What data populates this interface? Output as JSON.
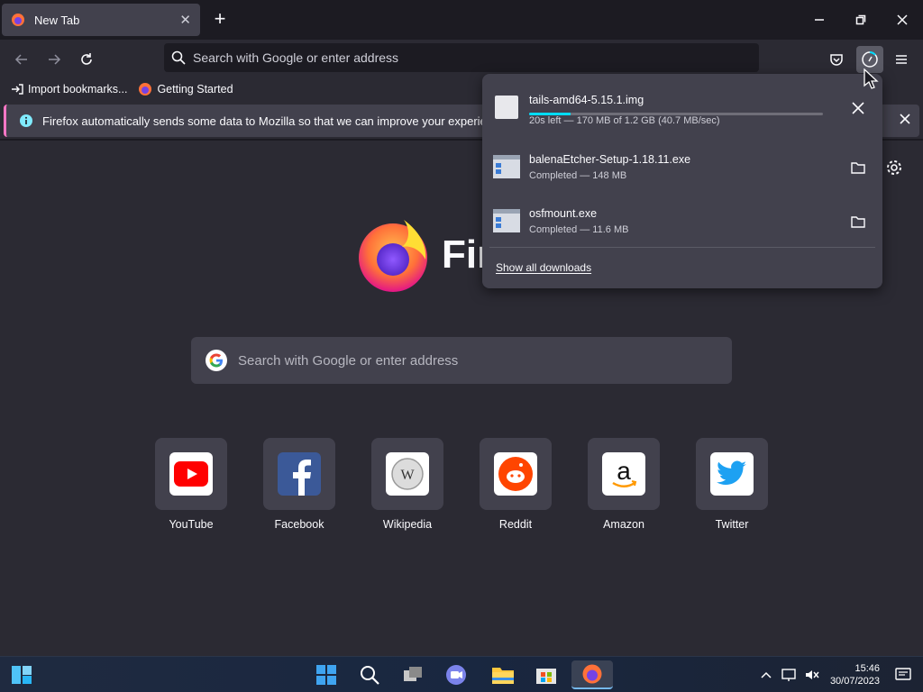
{
  "tabs": [
    {
      "title": "New Tab",
      "close_glyph": "✕"
    }
  ],
  "new_tab_glyph": "+",
  "window_controls": {
    "minimize": "minimize-icon",
    "restore": "restore-icon",
    "close": "close-icon"
  },
  "toolbar": {
    "address_placeholder": "Search with Google or enter address"
  },
  "bookmarks": [
    {
      "label": "Import bookmarks...",
      "icon": "import-icon"
    },
    {
      "label": "Getting Started",
      "icon": "firefox-icon"
    }
  ],
  "notification": {
    "text": "Firefox automatically sends some data to Mozilla so that we can improve your experience."
  },
  "page": {
    "wordmark": "Fir",
    "search_placeholder": "Search with Google or enter address",
    "top_sites": [
      {
        "label": "YouTube"
      },
      {
        "label": "Facebook"
      },
      {
        "label": "Wikipedia"
      },
      {
        "label": "Reddit"
      },
      {
        "label": "Amazon"
      },
      {
        "label": "Twitter"
      }
    ]
  },
  "downloads": {
    "items": [
      {
        "name": "tails-amd64-5.15.1.img",
        "status": "20s left — 170 MB of 1.2 GB (40.7 MB/sec)",
        "progress": 0.14,
        "action": "cancel-icon"
      },
      {
        "name": "balenaEtcher-Setup-1.18.11.exe",
        "status": "Completed — 148 MB",
        "action": "folder-icon"
      },
      {
        "name": "osfmount.exe",
        "status": "Completed — 11.6 MB",
        "action": "folder-icon"
      }
    ],
    "show_all": "Show all downloads"
  },
  "taskbar": {
    "time": "15:46",
    "date": "30/07/2023"
  },
  "colors": {
    "accent": "#00ddff",
    "notice_stripe": "#ff77c5",
    "chrome": "#1c1b22",
    "surface": "#2b2a33",
    "panel": "#42414d"
  }
}
